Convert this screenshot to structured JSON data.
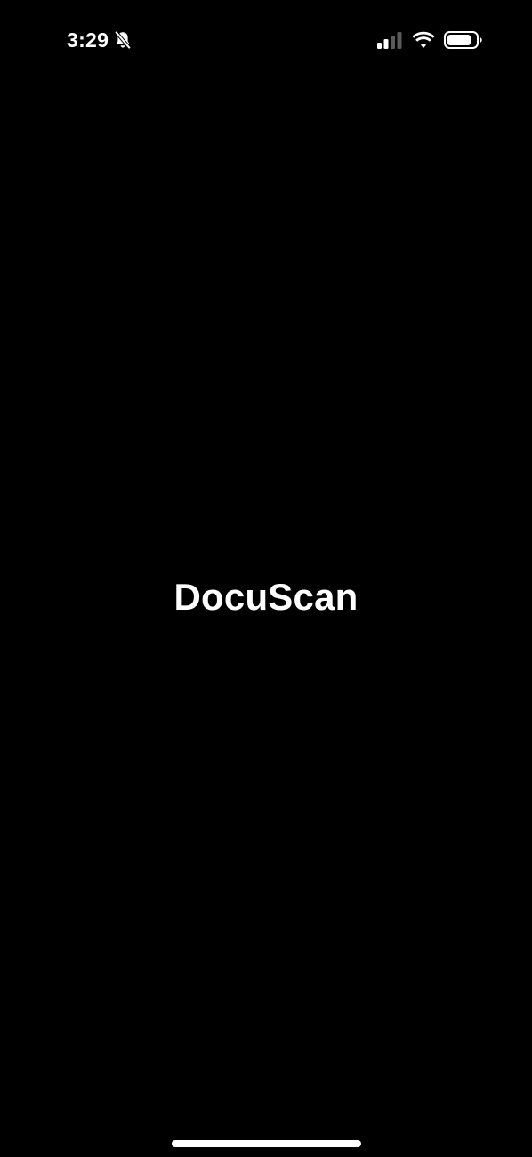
{
  "status_bar": {
    "time": "3:29",
    "icons": [
      "bell-slash-icon",
      "cellular-signal-icon",
      "wifi-icon",
      "battery-icon"
    ]
  },
  "splash": {
    "app_name": "DocuScan"
  },
  "colors": {
    "background": "#000000",
    "foreground": "#ffffff",
    "dim_signal": "#5a5a5a"
  }
}
